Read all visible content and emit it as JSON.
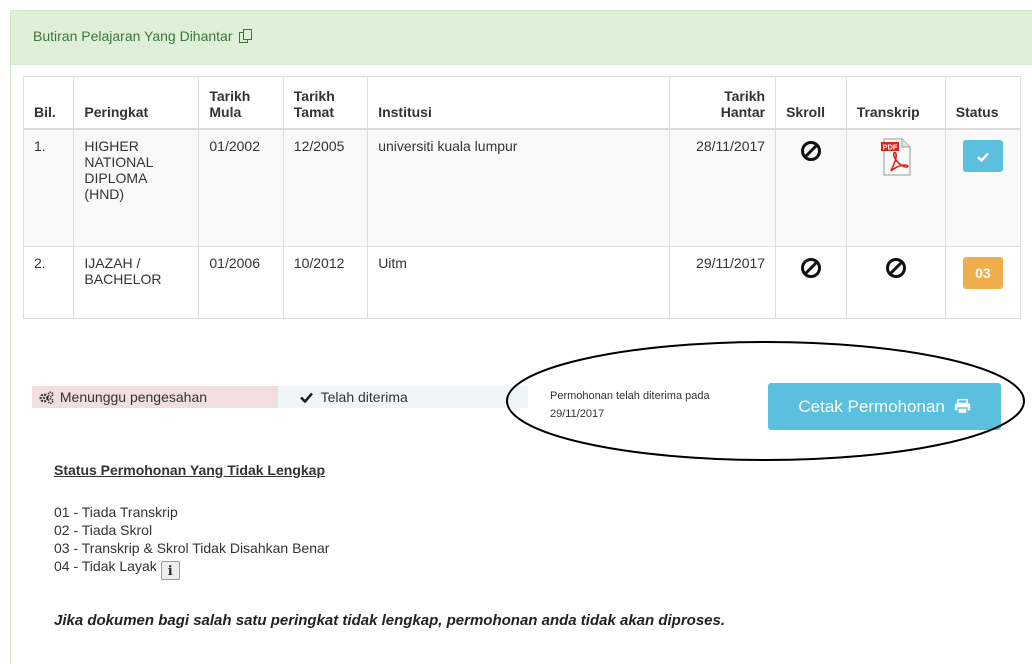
{
  "panel": {
    "title": "Butiran Pelajaran Yang Dihantar"
  },
  "table": {
    "headers": {
      "bil": "Bil.",
      "peringkat": "Peringkat",
      "mula_1": "Tarikh",
      "mula_2": "Mula",
      "tamat_1": "Tarikh",
      "tamat_2": "Tamat",
      "institusi": "Institusi",
      "hantar_1": "Tarikh",
      "hantar_2": "Hantar",
      "skroll": "Skroll",
      "transkrip": "Transkrip",
      "status": "Status"
    },
    "rows": [
      {
        "bil": "1.",
        "peringkat_lines": [
          "HIGHER",
          "NATIONAL",
          "DIPLOMA",
          "(HND)"
        ],
        "mula": "01/2002",
        "tamat": "12/2005",
        "institusi": "universiti kuala lumpur",
        "hantar": "28/11/2017",
        "skroll": "ban-icon",
        "transkrip": "pdf-icon",
        "status": "check-icon"
      },
      {
        "bil": "2.",
        "peringkat_lines": [
          "IJAZAH /",
          "BACHELOR"
        ],
        "mula": "01/2006",
        "tamat": "10/2012",
        "institusi": "Uitm",
        "hantar": "29/11/2017",
        "skroll": "ban-icon",
        "transkrip": "ban-icon",
        "status": "03"
      }
    ]
  },
  "legend": {
    "pending": "Menunggu pengesahan",
    "received": "Telah diterima"
  },
  "received_note": {
    "line1": "Permohonan telah diterima pada",
    "line2": "29/11/2017"
  },
  "print_button": "Cetak Permohonan",
  "status_section": {
    "title": "Status Permohonan Yang Tidak Lengkap",
    "codes": [
      "01 - Tiada Transkrip",
      "02 - Tiada Skrol",
      "03 - Transkrip & Skrol Tidak Disahkan Benar",
      "04 - Tidak Layak"
    ]
  },
  "info_icon_label": "i",
  "warning": "Jika dokumen bagi salah satu peringkat tidak lengkap, permohonan anda tidak akan diproses.",
  "colors": {
    "heading_bg": "#dff0d8",
    "heading_text": "#3c763d",
    "info": "#5bc0de",
    "warning": "#f0ad4e",
    "pending_bg": "#f2dede",
    "received_bg": "#eef6fa"
  }
}
